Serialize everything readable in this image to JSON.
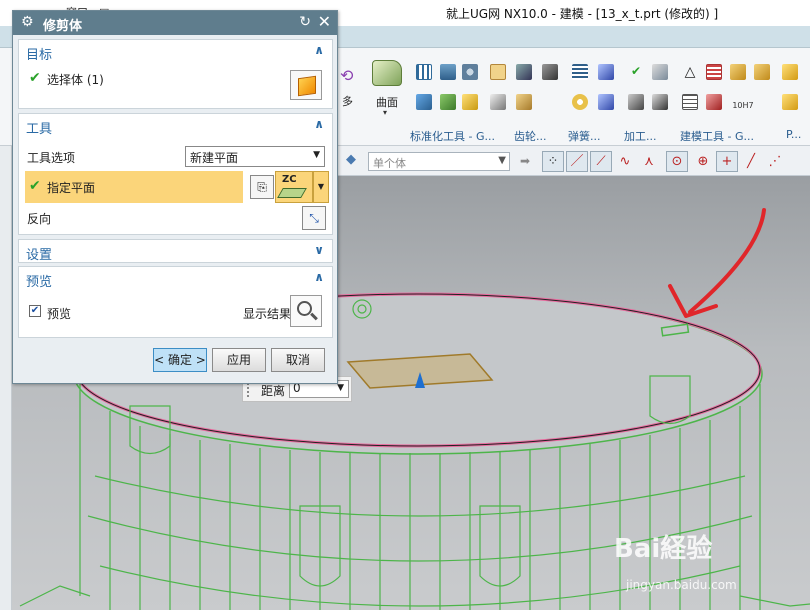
{
  "window": {
    "title": "就上UG网 NX10.0 - 建模 - [13_x_t.prt  (修改的) ]",
    "menu_fragment": "窗口 - □"
  },
  "ribbon": {
    "curve_label": "曲面",
    "more_label": "多",
    "group_labels": [
      "标准化工具 - G...",
      "齿轮...",
      "弹簧...",
      "加工...",
      "建模工具 - G...",
      "P..."
    ],
    "hole_icon_text": "10H7"
  },
  "selection_bar": {
    "filter_value": "单个体"
  },
  "dialog": {
    "title": "修剪体",
    "sections": {
      "target": {
        "label": "目标",
        "select_body": "选择体 (1)"
      },
      "tool": {
        "label": "工具",
        "tool_option_label": "工具选项",
        "tool_option_value": "新建平面",
        "specify_plane": "指定平面",
        "zc_label": "ZC",
        "reverse": "反向"
      },
      "settings": {
        "label": "设置"
      },
      "preview": {
        "label": "预览",
        "checkbox_label": "预览",
        "checked": true,
        "show_result": "显示结果"
      }
    },
    "buttons": {
      "ok": "< 确定 >",
      "apply": "应用",
      "cancel": "取消"
    }
  },
  "distance": {
    "label": "距离",
    "value": "0"
  },
  "watermark": {
    "main": "Bai経验",
    "sub": "jingyan.baidu.com"
  },
  "colors": {
    "wireframe": "#4db54a",
    "highlight": "#fbd57a",
    "edge_pink": "#e86a9e",
    "arrow_red": "#e0262a"
  }
}
